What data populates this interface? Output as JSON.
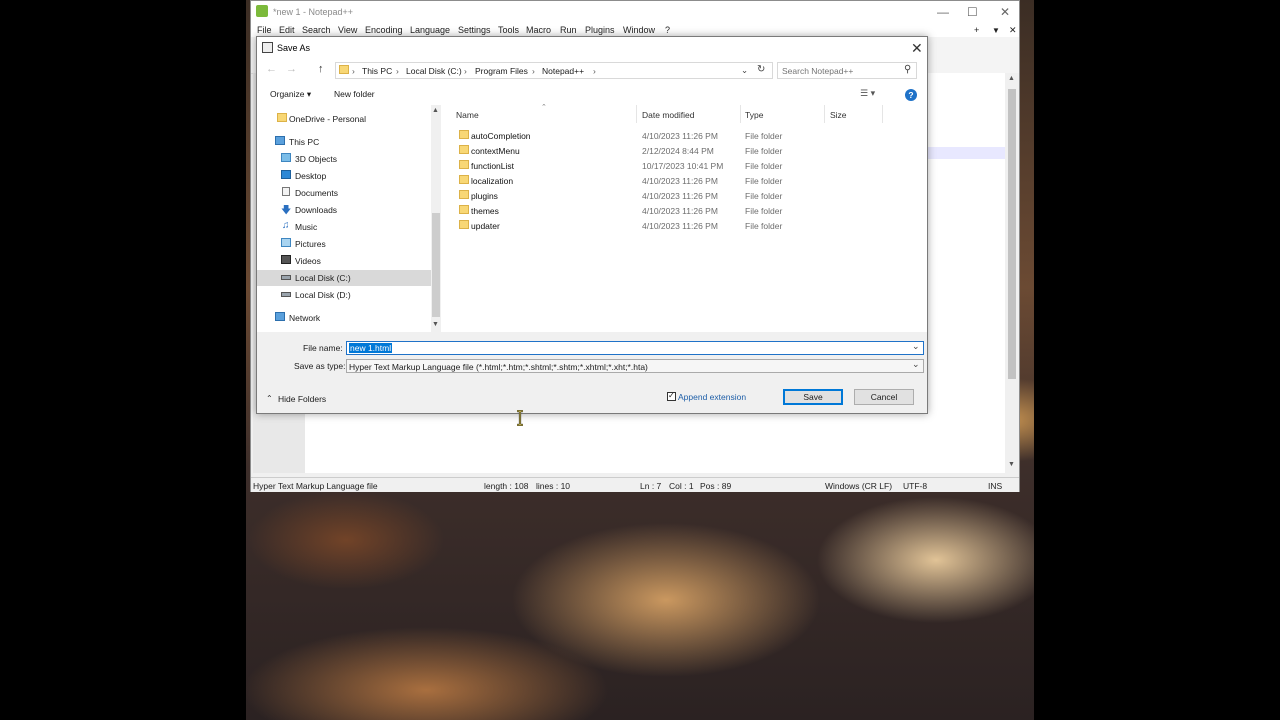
{
  "notepad": {
    "title": "*new 1 - Notepad++",
    "menu": [
      "File",
      "Edit",
      "Search",
      "View",
      "Encoding",
      "Language",
      "Settings",
      "Tools",
      "Macro",
      "Run",
      "Plugins",
      "Window",
      "?"
    ],
    "menu_right": [
      "+",
      "▼",
      "✕"
    ],
    "status": {
      "filetype": "Hyper Text Markup Language file",
      "length": "length : 108",
      "lines": "lines : 10",
      "ln": "Ln : 7",
      "col": "Col : 1",
      "pos": "Pos : 89",
      "eol": "Windows (CR LF)",
      "encoding": "UTF-8",
      "mode": "INS"
    }
  },
  "dialog": {
    "title": "Save As",
    "breadcrumb": [
      "This PC",
      "Local Disk (C:)",
      "Program Files",
      "Notepad++"
    ],
    "search_placeholder": "Search Notepad++",
    "organize_label": "Organize ▾",
    "new_folder_label": "New folder",
    "nav_items": [
      {
        "label": "OneDrive - Personal",
        "icon": "folder-icon"
      },
      {
        "label": "This PC",
        "icon": "computer-icon"
      },
      {
        "label": "3D Objects",
        "icon": "3d-objects-icon"
      },
      {
        "label": "Desktop",
        "icon": "desktop-icon"
      },
      {
        "label": "Documents",
        "icon": "documents-icon"
      },
      {
        "label": "Downloads",
        "icon": "downloads-icon"
      },
      {
        "label": "Music",
        "icon": "music-icon"
      },
      {
        "label": "Pictures",
        "icon": "pictures-icon"
      },
      {
        "label": "Videos",
        "icon": "videos-icon"
      },
      {
        "label": "Local Disk (C:)",
        "icon": "drive-icon"
      },
      {
        "label": "Local Disk (D:)",
        "icon": "drive-icon"
      },
      {
        "label": "Network",
        "icon": "network-icon"
      }
    ],
    "columns": [
      "Name",
      "Date modified",
      "Type",
      "Size"
    ],
    "files": [
      {
        "name": "autoCompletion",
        "date": "4/10/2023 11:26 PM",
        "type": "File folder"
      },
      {
        "name": "contextMenu",
        "date": "2/12/2024 8:44 PM",
        "type": "File folder"
      },
      {
        "name": "functionList",
        "date": "10/17/2023 10:41 PM",
        "type": "File folder"
      },
      {
        "name": "localization",
        "date": "4/10/2023 11:26 PM",
        "type": "File folder"
      },
      {
        "name": "plugins",
        "date": "4/10/2023 11:26 PM",
        "type": "File folder"
      },
      {
        "name": "themes",
        "date": "4/10/2023 11:26 PM",
        "type": "File folder"
      },
      {
        "name": "updater",
        "date": "4/10/2023 11:26 PM",
        "type": "File folder"
      }
    ],
    "file_name_label": "File name:",
    "file_name_value": "new 1.html",
    "save_type_label": "Save as type:",
    "save_type_value": "Hyper Text Markup Language file (*.html;*.htm;*.shtml;*.shtm;*.xhtml;*.xht;*.hta)",
    "hide_folders_label": "Hide Folders",
    "append_extension_label": "Append extension",
    "save_label": "Save",
    "cancel_label": "Cancel"
  }
}
